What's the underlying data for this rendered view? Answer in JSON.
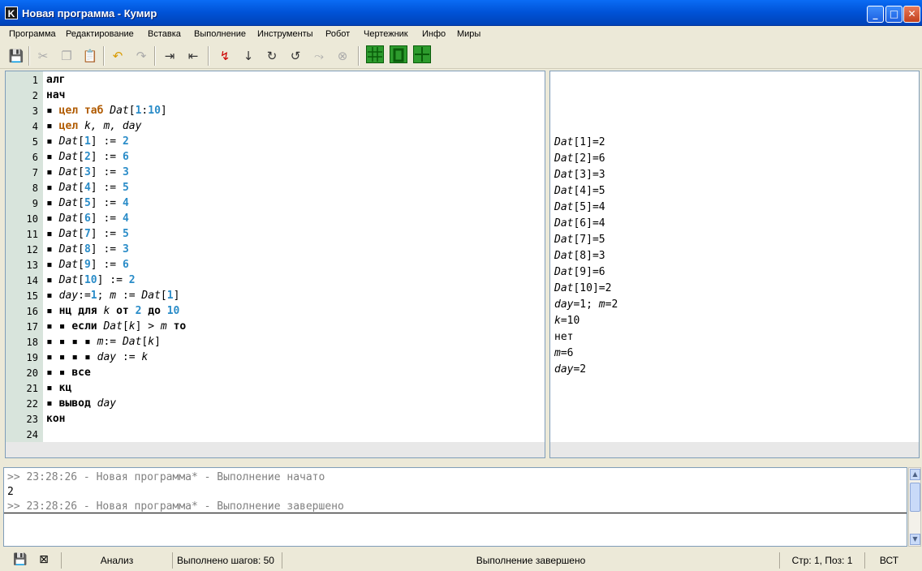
{
  "window": {
    "app_icon_letter": "K",
    "title": "Новая программа - Кумир"
  },
  "menu": [
    "Программа",
    "Редактирование",
    "Вставка",
    "Выполнение",
    "Инструменты",
    "Робот",
    "Чертежник",
    "Инфо",
    "Миры"
  ],
  "toolbar": {
    "icons": [
      "save-icon",
      "cut-icon",
      "copy-icon",
      "paste-icon",
      "undo-icon",
      "redo-icon",
      "indent-icon",
      "unindent-icon",
      "run-icon",
      "step-icon",
      "step-into-icon",
      "step-out-icon",
      "step-over-icon",
      "stop-icon",
      "grid-icon",
      "robot-icon",
      "draw-icon"
    ]
  },
  "editor": {
    "line_numbers": [
      "1",
      "2",
      "3",
      "4",
      "5",
      "6",
      "7",
      "8",
      "9",
      "10",
      "11",
      "12",
      "13",
      "14",
      "15",
      "16",
      "17",
      "18",
      "19",
      "20",
      "21",
      "22",
      "23",
      "24"
    ],
    "lines": [
      [
        {
          "t": "алг",
          "c": "kw"
        }
      ],
      [
        {
          "t": "нач",
          "c": "kw"
        }
      ],
      [
        {
          "t": "▪ ",
          "c": ""
        },
        {
          "t": "цел таб",
          "c": "type"
        },
        {
          "t": " ",
          "c": ""
        },
        {
          "t": "Dat",
          "c": "var"
        },
        {
          "t": "[",
          "c": ""
        },
        {
          "t": "1",
          "c": "num"
        },
        {
          "t": ":",
          "c": ""
        },
        {
          "t": "10",
          "c": "num"
        },
        {
          "t": "]",
          "c": ""
        }
      ],
      [
        {
          "t": "▪ ",
          "c": ""
        },
        {
          "t": "цел",
          "c": "type"
        },
        {
          "t": " ",
          "c": ""
        },
        {
          "t": "k, m, day",
          "c": "var"
        }
      ],
      [
        {
          "t": "▪ ",
          "c": ""
        },
        {
          "t": "Dat",
          "c": "var"
        },
        {
          "t": "[",
          "c": ""
        },
        {
          "t": "1",
          "c": "num"
        },
        {
          "t": "] := ",
          "c": ""
        },
        {
          "t": "2",
          "c": "num"
        }
      ],
      [
        {
          "t": "▪ ",
          "c": ""
        },
        {
          "t": "Dat",
          "c": "var"
        },
        {
          "t": "[",
          "c": ""
        },
        {
          "t": "2",
          "c": "num"
        },
        {
          "t": "] := ",
          "c": ""
        },
        {
          "t": "6",
          "c": "num"
        }
      ],
      [
        {
          "t": "▪ ",
          "c": ""
        },
        {
          "t": "Dat",
          "c": "var"
        },
        {
          "t": "[",
          "c": ""
        },
        {
          "t": "3",
          "c": "num"
        },
        {
          "t": "] := ",
          "c": ""
        },
        {
          "t": "3",
          "c": "num"
        }
      ],
      [
        {
          "t": "▪ ",
          "c": ""
        },
        {
          "t": "Dat",
          "c": "var"
        },
        {
          "t": "[",
          "c": ""
        },
        {
          "t": "4",
          "c": "num"
        },
        {
          "t": "] := ",
          "c": ""
        },
        {
          "t": "5",
          "c": "num"
        }
      ],
      [
        {
          "t": "▪ ",
          "c": ""
        },
        {
          "t": "Dat",
          "c": "var"
        },
        {
          "t": "[",
          "c": ""
        },
        {
          "t": "5",
          "c": "num"
        },
        {
          "t": "] := ",
          "c": ""
        },
        {
          "t": "4",
          "c": "num"
        }
      ],
      [
        {
          "t": "▪ ",
          "c": ""
        },
        {
          "t": "Dat",
          "c": "var"
        },
        {
          "t": "[",
          "c": ""
        },
        {
          "t": "6",
          "c": "num"
        },
        {
          "t": "] := ",
          "c": ""
        },
        {
          "t": "4",
          "c": "num"
        }
      ],
      [
        {
          "t": "▪ ",
          "c": ""
        },
        {
          "t": "Dat",
          "c": "var"
        },
        {
          "t": "[",
          "c": ""
        },
        {
          "t": "7",
          "c": "num"
        },
        {
          "t": "] := ",
          "c": ""
        },
        {
          "t": "5",
          "c": "num"
        }
      ],
      [
        {
          "t": "▪ ",
          "c": ""
        },
        {
          "t": "Dat",
          "c": "var"
        },
        {
          "t": "[",
          "c": ""
        },
        {
          "t": "8",
          "c": "num"
        },
        {
          "t": "] := ",
          "c": ""
        },
        {
          "t": "3",
          "c": "num"
        }
      ],
      [
        {
          "t": "▪ ",
          "c": ""
        },
        {
          "t": "Dat",
          "c": "var"
        },
        {
          "t": "[",
          "c": ""
        },
        {
          "t": "9",
          "c": "num"
        },
        {
          "t": "] := ",
          "c": ""
        },
        {
          "t": "6",
          "c": "num"
        }
      ],
      [
        {
          "t": "▪ ",
          "c": ""
        },
        {
          "t": "Dat",
          "c": "var"
        },
        {
          "t": "[",
          "c": ""
        },
        {
          "t": "10",
          "c": "num"
        },
        {
          "t": "] := ",
          "c": ""
        },
        {
          "t": "2",
          "c": "num"
        }
      ],
      [
        {
          "t": "▪ ",
          "c": ""
        },
        {
          "t": "day",
          "c": "var"
        },
        {
          "t": ":=",
          "c": ""
        },
        {
          "t": "1",
          "c": "num"
        },
        {
          "t": "; ",
          "c": ""
        },
        {
          "t": "m",
          "c": "var"
        },
        {
          "t": " := ",
          "c": ""
        },
        {
          "t": "Dat",
          "c": "var"
        },
        {
          "t": "[",
          "c": ""
        },
        {
          "t": "1",
          "c": "num"
        },
        {
          "t": "]",
          "c": ""
        }
      ],
      [
        {
          "t": "▪ ",
          "c": ""
        },
        {
          "t": "нц для",
          "c": "kw"
        },
        {
          "t": " ",
          "c": ""
        },
        {
          "t": "k",
          "c": "var"
        },
        {
          "t": " ",
          "c": ""
        },
        {
          "t": "от",
          "c": "kw"
        },
        {
          "t": " ",
          "c": ""
        },
        {
          "t": "2",
          "c": "num"
        },
        {
          "t": " ",
          "c": ""
        },
        {
          "t": "до",
          "c": "kw"
        },
        {
          "t": " ",
          "c": ""
        },
        {
          "t": "10",
          "c": "num"
        }
      ],
      [
        {
          "t": "▪ ▪ ",
          "c": ""
        },
        {
          "t": "если",
          "c": "kw"
        },
        {
          "t": " ",
          "c": ""
        },
        {
          "t": "Dat",
          "c": "var"
        },
        {
          "t": "[",
          "c": ""
        },
        {
          "t": "k",
          "c": "var"
        },
        {
          "t": "] > ",
          "c": ""
        },
        {
          "t": "m",
          "c": "var"
        },
        {
          "t": " ",
          "c": ""
        },
        {
          "t": "то",
          "c": "kw"
        }
      ],
      [
        {
          "t": "▪ ▪ ▪ ▪ ",
          "c": ""
        },
        {
          "t": "m",
          "c": "var"
        },
        {
          "t": ":= ",
          "c": ""
        },
        {
          "t": "Dat",
          "c": "var"
        },
        {
          "t": "[",
          "c": ""
        },
        {
          "t": "k",
          "c": "var"
        },
        {
          "t": "]",
          "c": ""
        }
      ],
      [
        {
          "t": "▪ ▪ ▪ ▪ ",
          "c": ""
        },
        {
          "t": "day",
          "c": "var"
        },
        {
          "t": " := ",
          "c": ""
        },
        {
          "t": "k",
          "c": "var"
        }
      ],
      [
        {
          "t": "▪ ▪ ",
          "c": ""
        },
        {
          "t": "все",
          "c": "kw"
        }
      ],
      [
        {
          "t": "▪ ",
          "c": ""
        },
        {
          "t": "кц",
          "c": "kw"
        }
      ],
      [
        {
          "t": "▪ ",
          "c": ""
        },
        {
          "t": "вывод",
          "c": "kw"
        },
        {
          "t": " ",
          "c": ""
        },
        {
          "t": "day",
          "c": "var"
        }
      ],
      [
        {
          "t": "кон",
          "c": "kw"
        }
      ],
      []
    ]
  },
  "output_pane": {
    "lines": [
      [
        {
          "t": "Dat",
          "c": "var"
        },
        {
          "t": "[1]=2",
          "c": ""
        }
      ],
      [
        {
          "t": "Dat",
          "c": "var"
        },
        {
          "t": "[2]=6",
          "c": ""
        }
      ],
      [
        {
          "t": "Dat",
          "c": "var"
        },
        {
          "t": "[3]=3",
          "c": ""
        }
      ],
      [
        {
          "t": "Dat",
          "c": "var"
        },
        {
          "t": "[4]=5",
          "c": ""
        }
      ],
      [
        {
          "t": "Dat",
          "c": "var"
        },
        {
          "t": "[5]=4",
          "c": ""
        }
      ],
      [
        {
          "t": "Dat",
          "c": "var"
        },
        {
          "t": "[6]=4",
          "c": ""
        }
      ],
      [
        {
          "t": "Dat",
          "c": "var"
        },
        {
          "t": "[7]=5",
          "c": ""
        }
      ],
      [
        {
          "t": "Dat",
          "c": "var"
        },
        {
          "t": "[8]=3",
          "c": ""
        }
      ],
      [
        {
          "t": "Dat",
          "c": "var"
        },
        {
          "t": "[9]=6",
          "c": ""
        }
      ],
      [
        {
          "t": "Dat",
          "c": "var"
        },
        {
          "t": "[10]=2",
          "c": ""
        }
      ],
      [
        {
          "t": "day",
          "c": "var"
        },
        {
          "t": "=1; ",
          "c": ""
        },
        {
          "t": "m",
          "c": "var"
        },
        {
          "t": "=2",
          "c": ""
        }
      ],
      [
        {
          "t": "k",
          "c": "var"
        },
        {
          "t": "=10",
          "c": ""
        }
      ],
      [
        {
          "t": "нет",
          "c": ""
        }
      ],
      [
        {
          "t": "m",
          "c": "var"
        },
        {
          "t": "=6",
          "c": ""
        }
      ],
      [
        {
          "t": "day",
          "c": "var"
        },
        {
          "t": "=2",
          "c": ""
        }
      ]
    ]
  },
  "console": {
    "line1": ">> 23:28:26 - Новая программа* - Выполнение начато",
    "line2": "2",
    "line3": ">> 23:28:26 - Новая программа* - Выполнение завершено"
  },
  "statusbar": {
    "analysis": "Анализ",
    "steps": "Выполнено шагов: 50",
    "status": "Выполнение завершено",
    "position": "Стр: 1, Поз: 1",
    "mode": "ВСТ"
  }
}
